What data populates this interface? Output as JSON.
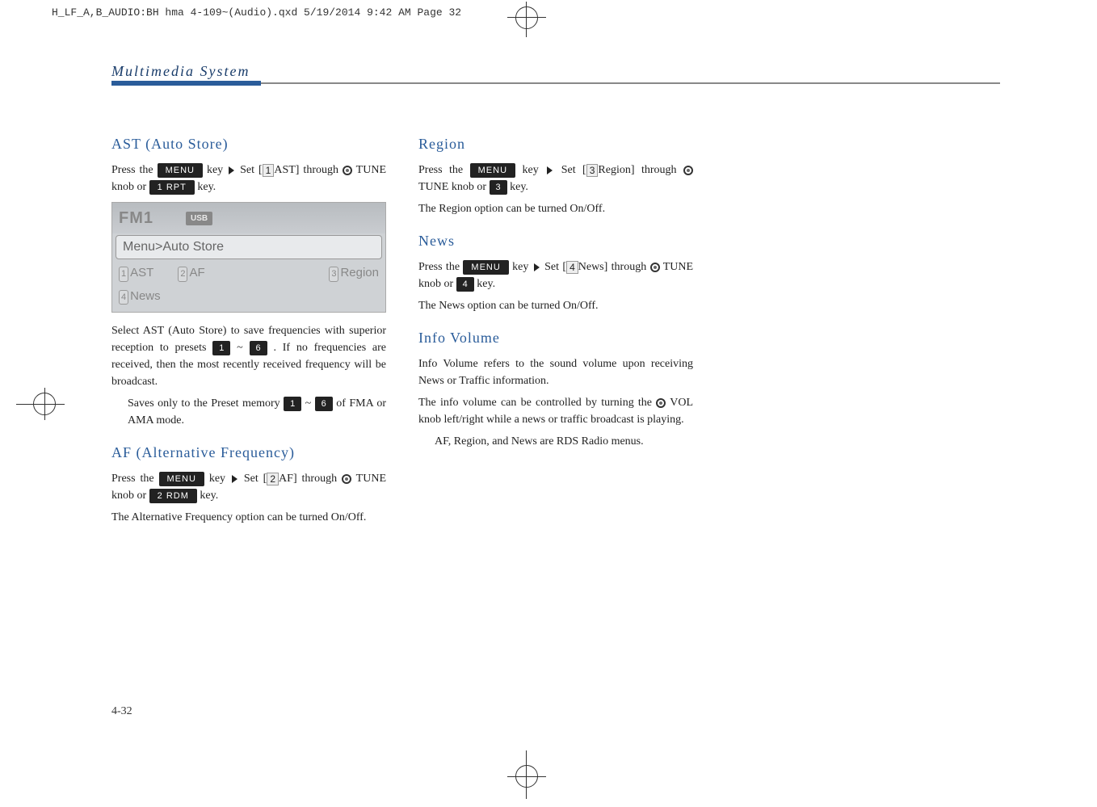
{
  "header": {
    "file_info": "H_LF_A,B_AUDIO:BH hma 4-109~(Audio).qxd  5/19/2014  9:42 AM  Page 32"
  },
  "page_title": "Multimedia System",
  "page_number": "4-32",
  "buttons": {
    "menu": "MENU",
    "rpt": "1 RPT",
    "rdm": "2 RDM",
    "num1": "1",
    "num3": "3",
    "num4": "4",
    "num6": "6"
  },
  "boxed": {
    "b1": "1",
    "b2": "2",
    "b3": "3",
    "b4": "4"
  },
  "radio_screen": {
    "fm": "FM1",
    "usb": "USB",
    "menu_row": "Menu>Auto Store",
    "row_items": [
      "AST",
      "AF",
      "Region",
      "News"
    ],
    "row_nums": [
      "1",
      "2",
      "3",
      "4"
    ]
  },
  "left": {
    "ast_header": "AST (Auto Store)",
    "ast_p1a": "Press the ",
    "ast_p1b": " key",
    "ast_p1c": "Set [",
    "ast_p1d": "AST] through ",
    "ast_p1e": " TUNE knob or ",
    "ast_p1f": " key.",
    "ast_p2a": "Select AST (Auto Store) to save frequencies with superior reception to presets ",
    "ast_p2b": " ~ ",
    "ast_p2c": " . If no frequencies are received, then the most recently received frequency will be broadcast.",
    "ast_note_a": "Saves only to the Preset memory ",
    "ast_note_b": " ~ ",
    "ast_note_c": " of FMA or AMA mode.",
    "af_header": "AF (Alternative Frequency)",
    "af_p1a": "Press the ",
    "af_p1b": " key",
    "af_p1c": "Set [",
    "af_p1d": "AF] through ",
    "af_p1e": " TUNE knob or ",
    "af_p1f": " key.",
    "af_p2": "The Alternative Frequency option can be turned On/Off."
  },
  "right": {
    "region_header": "Region",
    "region_p1a": "Press the ",
    "region_p1b": " key",
    "region_p1c": "Set [",
    "region_p1d": "Region] through ",
    "region_p1e": " TUNE knob or ",
    "region_p1f": " key.",
    "region_p2": "The Region option can be turned On/Off.",
    "news_header": "News",
    "news_p1a": "Press the ",
    "news_p1b": " key",
    "news_p1c": "Set [",
    "news_p1d": "News] through ",
    "news_p1e": " TUNE knob or ",
    "news_p1f": " key.",
    "news_p2": "The News option can be turned On/Off.",
    "info_header": "Info Volume",
    "info_p1": "Info Volume refers to the sound volume upon receiving News or Traffic information.",
    "info_p2a": "The info volume can be controlled by turning the ",
    "info_p2b": " VOL knob left/right while a news or traffic broadcast is playing.",
    "info_note": "AF, Region, and News are RDS Radio menus."
  }
}
